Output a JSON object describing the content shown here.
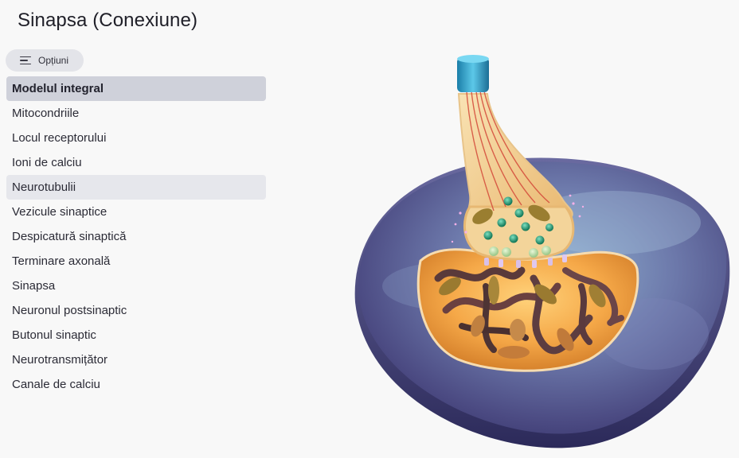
{
  "window": {
    "title": "Sinapsa (Conexiune)"
  },
  "options": {
    "label": "Opțiuni",
    "icon": "menu-lines-icon"
  },
  "menu": {
    "items": [
      {
        "label": "Modelul integral",
        "state": "selected"
      },
      {
        "label": "Mitocondriile",
        "state": "normal"
      },
      {
        "label": "Locul receptorului",
        "state": "normal"
      },
      {
        "label": "Ioni de calciu",
        "state": "normal"
      },
      {
        "label": "Neurotubulii",
        "state": "hover"
      },
      {
        "label": "Vezicule sinaptice",
        "state": "normal"
      },
      {
        "label": "Despicatură sinaptică",
        "state": "normal"
      },
      {
        "label": "Terminare axonală",
        "state": "normal"
      },
      {
        "label": "Sinapsa",
        "state": "normal"
      },
      {
        "label": "Neuronul postsinaptic",
        "state": "normal"
      },
      {
        "label": "Butonul sinaptic",
        "state": "normal"
      },
      {
        "label": "Neurotransmițător",
        "state": "normal"
      },
      {
        "label": "Canale de calciu",
        "state": "normal"
      }
    ]
  },
  "colors": {
    "selected_bg": "#cfd1da",
    "hover_bg": "#e6e7ec",
    "postsynaptic_surface": "#5a5a8c",
    "postsynaptic_interior": "#f0a040",
    "axon_cap": "#2aa0c8",
    "terminal": "#f3d49a",
    "mitochondria": "#8a6a2a",
    "vesicles": "#2a9a7a"
  }
}
